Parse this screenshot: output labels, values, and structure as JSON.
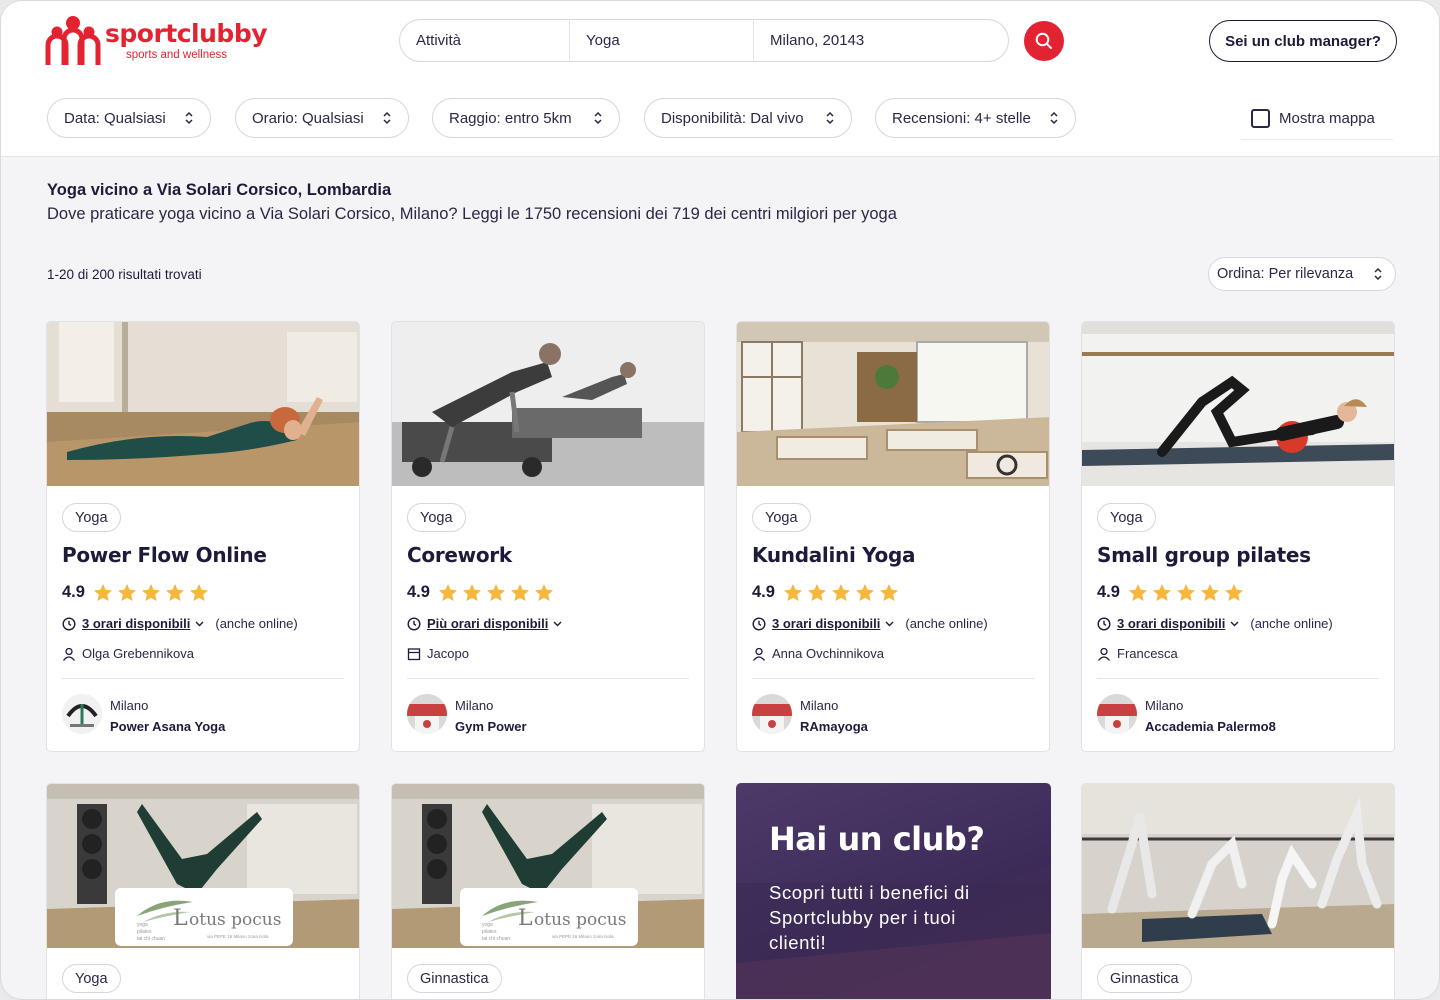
{
  "header": {
    "logo_text": "sportclubby",
    "logo_tagline": "sports and wellness",
    "search": {
      "activity_label": "Attività",
      "activity_value": "Yoga",
      "location_value": "Milano, 20143"
    },
    "club_manager_label": "Sei un club manager?"
  },
  "filters": [
    {
      "label": "Data: Qualsiasi"
    },
    {
      "label": "Orario: Qualsiasi"
    },
    {
      "label": "Raggio: entro 5km"
    },
    {
      "label": "Disponibilità: Dal vivo"
    },
    {
      "label": "Recensioni: 4+ stelle"
    }
  ],
  "map_toggle": {
    "label": "Mostra mappa",
    "checked": false
  },
  "intro": {
    "title": "Yoga vicino a Via Solari Corsico, Lombardia",
    "description": "Dove praticare yoga vicino a Via Solari Corsico, Milano? Leggi le 1750 recensioni dei 719 dei centri milgiori per yoga"
  },
  "results": {
    "count_label": "1-20 di 200 risultati trovati",
    "sort_label": "Ordina: Per rilevanza"
  },
  "cards": [
    {
      "tag": "Yoga",
      "title": "Power Flow Online",
      "rating": "4.9",
      "stars": 5,
      "schedule": "3 orari disponibili",
      "online": "(anche online)",
      "instructor": "Olga Grebennikova",
      "instructor_icon": "person-icon",
      "city": "Milano",
      "club": "Power Asana Yoga"
    },
    {
      "tag": "Yoga",
      "title": "Corework",
      "rating": "4.9",
      "stars": 5,
      "schedule": "Più orari disponibili",
      "online": "",
      "instructor": "Jacopo",
      "instructor_icon": "calendar-icon",
      "city": "Milano",
      "club": "Gym Power"
    },
    {
      "tag": "Yoga",
      "title": "Kundalini Yoga",
      "rating": "4.9",
      "stars": 5,
      "schedule": "3 orari disponibili",
      "online": "(anche online)",
      "instructor": "Anna Ovchinnikova",
      "instructor_icon": "person-icon",
      "city": "Milano",
      "club": "RAmayoga"
    },
    {
      "tag": "Yoga",
      "title": "Small group pilates",
      "rating": "4.9",
      "stars": 5,
      "schedule": "3 orari disponibili",
      "online": "(anche online)",
      "instructor": "Francesca",
      "instructor_icon": "person-icon",
      "city": "Milano",
      "club": "Accademia Palermo8"
    }
  ],
  "cards_row2": [
    {
      "tag": "Yoga",
      "logo_text": "otus pocus",
      "logo_initial": "L",
      "logo_sub1": "yoga",
      "logo_sub2": "pilates",
      "logo_sub3": "tai chi chuan",
      "logo_address": "via PEPE 16 Milano zona Isola"
    },
    {
      "tag": "Ginnastica",
      "logo_text": "otus pocus",
      "logo_initial": "L",
      "logo_sub1": "yoga",
      "logo_sub2": "pilates",
      "logo_sub3": "tai chi chuan",
      "logo_address": "via PEPE 16 Milano zona Isola"
    },
    {
      "tag": "Ginnastica"
    }
  ],
  "promo": {
    "title": "Hai un club?",
    "text": "Scopri tutti i benefici di Sportclubby per i tuoi clienti!"
  },
  "colors": {
    "brand_red": "#e32332",
    "navy": "#1d1b3a",
    "star": "#f6b73c",
    "promo_purple": "#3c2b58"
  }
}
